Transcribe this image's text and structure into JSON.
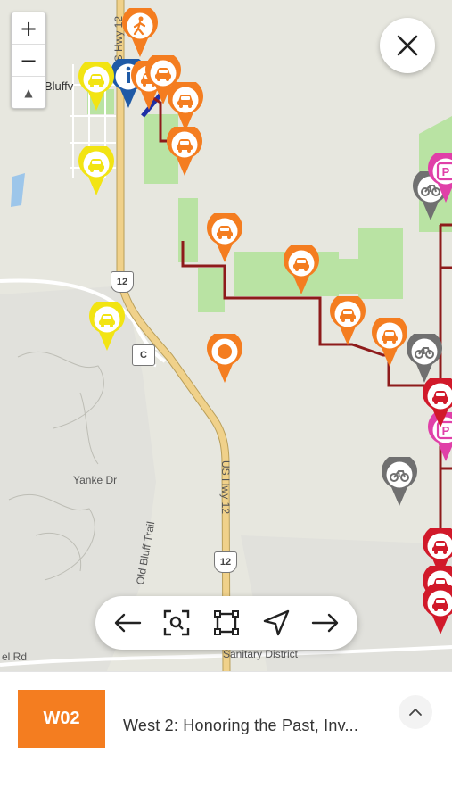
{
  "map": {
    "zoom_in": "+",
    "zoom_out": "−",
    "compass": "▲",
    "labels": {
      "town": "Bluffv",
      "hwy12_north": "US Hwy 12",
      "hwy12_south": "US Hwy 12",
      "yanke": "Yanke Dr",
      "old_bluff": "Old Bluff Trail",
      "el_rd": "el Rd",
      "sanitary": "Sanitary District"
    },
    "shields": {
      "us12_a": "12",
      "county_c": "C",
      "us12_b": "12"
    },
    "markers": [
      {
        "kind": "walk",
        "color": "#f47d20"
      },
      {
        "kind": "info",
        "color": "#1f5aa6"
      },
      {
        "kind": "car",
        "color": "#f47d20"
      },
      {
        "kind": "car",
        "color": "#f47d20"
      },
      {
        "kind": "car",
        "color": "#f47d20"
      },
      {
        "kind": "car",
        "color": "#f47d20"
      },
      {
        "kind": "car",
        "color": "#f47d20"
      },
      {
        "kind": "car",
        "color": "#f47d20"
      },
      {
        "kind": "car",
        "color": "#f47d20"
      },
      {
        "kind": "car",
        "color": "#f47d20"
      },
      {
        "kind": "selected",
        "color": "#f47d20"
      },
      {
        "kind": "car",
        "color": "#f2e413"
      },
      {
        "kind": "car",
        "color": "#f2e413"
      },
      {
        "kind": "car",
        "color": "#f2e413"
      },
      {
        "kind": "bike",
        "color": "#707070"
      },
      {
        "kind": "bike",
        "color": "#707070"
      },
      {
        "kind": "bike",
        "color": "#707070"
      },
      {
        "kind": "parking",
        "color": "#e040a8"
      },
      {
        "kind": "parking",
        "color": "#e040a8"
      },
      {
        "kind": "car",
        "color": "#d1192a"
      },
      {
        "kind": "car",
        "color": "#d1192a"
      },
      {
        "kind": "car",
        "color": "#d1192a"
      },
      {
        "kind": "car",
        "color": "#d1192a"
      }
    ]
  },
  "toolbar": {
    "buttons": [
      "arrow-left-icon",
      "zoom-search-icon",
      "fit-bounds-icon",
      "locate-icon",
      "arrow-right-icon"
    ]
  },
  "route": {
    "code": "W02",
    "title": "West 2: Honoring the Past, Inv..."
  },
  "colors": {
    "accent": "#f47d20",
    "route_line": "#8e1b1b",
    "park": "#b9e3a3",
    "highway": "#f0d18a"
  }
}
